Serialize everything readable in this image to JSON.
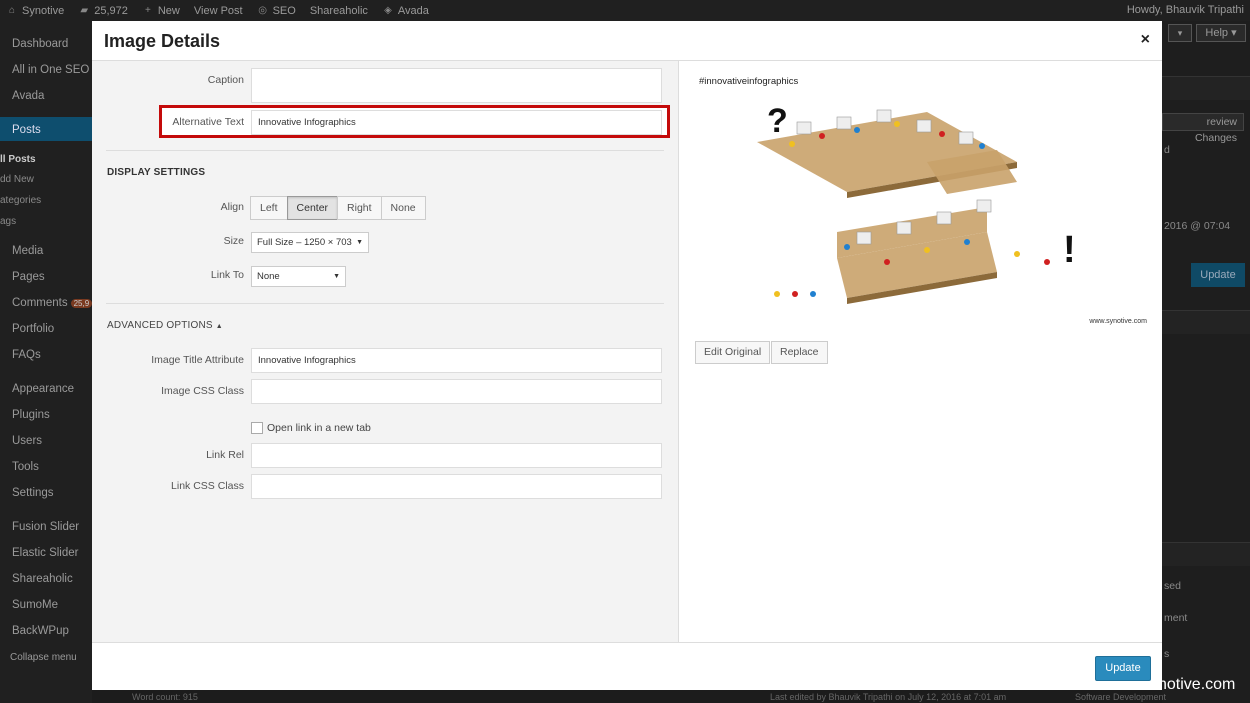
{
  "admin_bar": {
    "site": "Synotive",
    "comments_count": "25,972",
    "new": "New",
    "view_post": "View Post",
    "seo": "SEO",
    "shareaholic": "Shareaholic",
    "avada": "Avada",
    "howdy": "Howdy, Bhauvik Tripathi"
  },
  "sidebar": {
    "items": [
      "Dashboard",
      "All in One SEO",
      "Avada",
      "Posts",
      "Media",
      "Pages",
      "Comments",
      "Portfolio",
      "FAQs",
      "Appearance",
      "Plugins",
      "Users",
      "Tools",
      "Settings",
      "Fusion Slider",
      "Elastic Slider",
      "Shareaholic",
      "SumoMe",
      "BackWPup",
      "Collapse menu"
    ],
    "comments_badge": "25,9",
    "posts_sub": [
      "ll Posts",
      "dd New",
      "ategories",
      "ags"
    ]
  },
  "right_panel": {
    "help": "Help",
    "preview_changes": "review Changes",
    "date": "2016 @ 07:04",
    "update": "Update",
    "link_fragment": "d",
    "used": "sed",
    "ment": "ment",
    "s": "s"
  },
  "modal": {
    "title": "Image Details",
    "close_icon": "×",
    "caption_label": "Caption",
    "caption_value": "",
    "alt_label": "Alternative Text",
    "alt_value": "Innovative Infographics",
    "display_settings": "DISPLAY SETTINGS",
    "align_label": "Align",
    "align_options": [
      "Left",
      "Center",
      "Right",
      "None"
    ],
    "align_selected": "Center",
    "size_label": "Size",
    "size_value": "Full Size – 1250 × 703",
    "link_to_label": "Link To",
    "link_to_value": "None",
    "advanced_options": "ADVANCED OPTIONS",
    "advanced_arrow": "▲",
    "title_attr_label": "Image Title Attribute",
    "title_attr_value": "Innovative Infographics",
    "css_class_label": "Image CSS Class",
    "css_class_value": "",
    "open_new_tab": "Open link in a new tab",
    "link_rel_label": "Link Rel",
    "link_rel_value": "",
    "link_css_label": "Link CSS Class",
    "link_css_value": "",
    "preview_caption": "#innovativeinfographics",
    "preview_credit": "www.synotive.com",
    "edit_original": "Edit Original",
    "replace": "Replace",
    "update": "Update"
  },
  "watermark": "notive.com",
  "bottom": {
    "left": "Word count: 915",
    "mid": "Last edited by Bhauvik Tripathi on July 12, 2016 at 7:01 am",
    "right": "Software Development"
  },
  "colors": {
    "accent": "#2a8bbd",
    "highlight": "#c40a0a",
    "admin_bg": "#202020"
  }
}
